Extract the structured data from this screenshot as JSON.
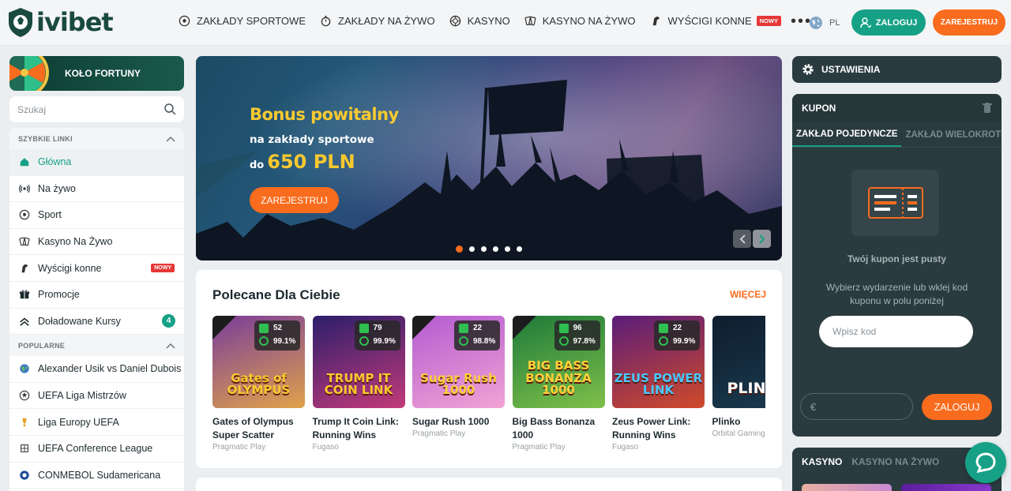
{
  "brand": {
    "name": "ivibet"
  },
  "nav": {
    "items": [
      {
        "label": "ZAKŁADY SPORTOWE",
        "icon": "soccer-ball-icon"
      },
      {
        "label": "ZAKŁADY NA ŻYWO",
        "icon": "live-stopwatch-icon"
      },
      {
        "label": "KASYNO",
        "icon": "casino-chip-icon"
      },
      {
        "label": "KASYNO NA ŻYWO",
        "icon": "cards-icon"
      },
      {
        "label": "WYŚCIGI KONNE",
        "icon": "horse-icon",
        "badge": "NOWY"
      }
    ],
    "more": "•••"
  },
  "header": {
    "lang": "PL",
    "login_label": "ZALOGUJ",
    "register_label": "ZAREJESTRUJ"
  },
  "sidebar": {
    "fortune_label": "KOŁO FORTUNY",
    "search_placeholder": "Szukaj",
    "quick_links_title": "SZYBKIE LINKI",
    "popular_title": "POPULARNE",
    "quick_links": [
      {
        "label": "Główna",
        "icon": "home-icon",
        "active": true
      },
      {
        "label": "Na żywo",
        "icon": "broadcast-icon"
      },
      {
        "label": "Sport",
        "icon": "soccer-ball-icon"
      },
      {
        "label": "Kasyno Na Żywo",
        "icon": "cards-icon"
      },
      {
        "label": "Wyścigi konne",
        "icon": "horse-icon",
        "badge": "NOWY"
      },
      {
        "label": "Promocje",
        "icon": "gift-icon"
      },
      {
        "label": "Doładowane Kursy",
        "icon": "boost-chevrons-icon",
        "count": "4"
      }
    ],
    "popular": [
      {
        "label": "Alexander Usik vs Daniel Dubois",
        "icon": "globe-icon"
      },
      {
        "label": "UEFA Liga Mistrzów",
        "icon": "champions-league-icon"
      },
      {
        "label": "Liga Europy UEFA",
        "icon": "europa-league-icon"
      },
      {
        "label": "UEFA Conference League",
        "icon": "conference-league-icon"
      },
      {
        "label": "CONMEBOL Sudamericana",
        "icon": "conmebol-icon"
      }
    ]
  },
  "banner": {
    "title": "Bonus powitalny",
    "subtitle": "na zakłady sportowe",
    "amount_prefix": "do",
    "amount": "650 PLN",
    "cta": "ZAREJESTRUJ",
    "slides": 6,
    "active_slide": 0
  },
  "recommended": {
    "title": "Polecane Dla Ciebie",
    "more": "WIĘCEJ",
    "games": [
      {
        "name": "Gates of Olympus Super Scatter",
        "provider": "Pragmatic Play",
        "stat": "52",
        "rtp": "99.1%",
        "logo": "Gates of OLYMPUS",
        "drops": true,
        "colors": [
          "#7a3d9a",
          "#e0a24a"
        ],
        "logo_color": "#f9c92f"
      },
      {
        "name": "Trump It Coin Link: Running Wins",
        "provider": "Fugaso",
        "stat": "79",
        "rtp": "99.9%",
        "logo": "TRUMP IT COIN LINK",
        "drops": false,
        "colors": [
          "#2c1e6b",
          "#c23a7a"
        ],
        "logo_color": "#f9c92f"
      },
      {
        "name": "Sugar Rush 1000",
        "provider": "Pragmatic Play",
        "stat": "22",
        "rtp": "98.8%",
        "logo": "Sugar Rush 1000",
        "drops": true,
        "colors": [
          "#b35bd1",
          "#f2a3d4"
        ],
        "logo_color": "#ffcf3a"
      },
      {
        "name": "Big Bass Bonanza 1000",
        "provider": "Pragmatic Play",
        "stat": "96",
        "rtp": "97.8%",
        "logo": "BIG BASS BONANZA 1000",
        "drops": true,
        "colors": [
          "#1e7a3a",
          "#7fc04a"
        ],
        "logo_color": "#ffd23a"
      },
      {
        "name": "Zeus Power Link: Running Wins",
        "provider": "Fugaso",
        "stat": "22",
        "rtp": "99.9%",
        "logo": "ZEUS POWER LINK",
        "drops": false,
        "colors": [
          "#5a1d7a",
          "#d14a2a"
        ],
        "logo_color": "#4ac8ff"
      },
      {
        "name": "Plinko",
        "provider": "Orbital Gaming",
        "stat": "",
        "rtp": "",
        "logo": "PLINKO",
        "drops": false,
        "colors": [
          "#0e1e2e",
          "#1b3a4f"
        ],
        "logo_color": "#ffffff"
      }
    ]
  },
  "settings": {
    "label": "USTAWIENIA"
  },
  "coupon": {
    "title": "KUPON",
    "tab_single": "ZAKŁAD POJEDYNCZE",
    "tab_multi": "ZAKŁAD WIELOKROTNY",
    "empty_title": "Twój kupon jest pusty",
    "empty_text": "Wybierz wydarzenie lub wklej kod kuponu w polu poniżej",
    "code_placeholder": "Wpisz kod",
    "stake_currency": "€",
    "login_label": "ZALOGUJ"
  },
  "casino": {
    "tab_casino": "KASYNO",
    "tab_live": "KASYNO NA ŻYWO"
  }
}
